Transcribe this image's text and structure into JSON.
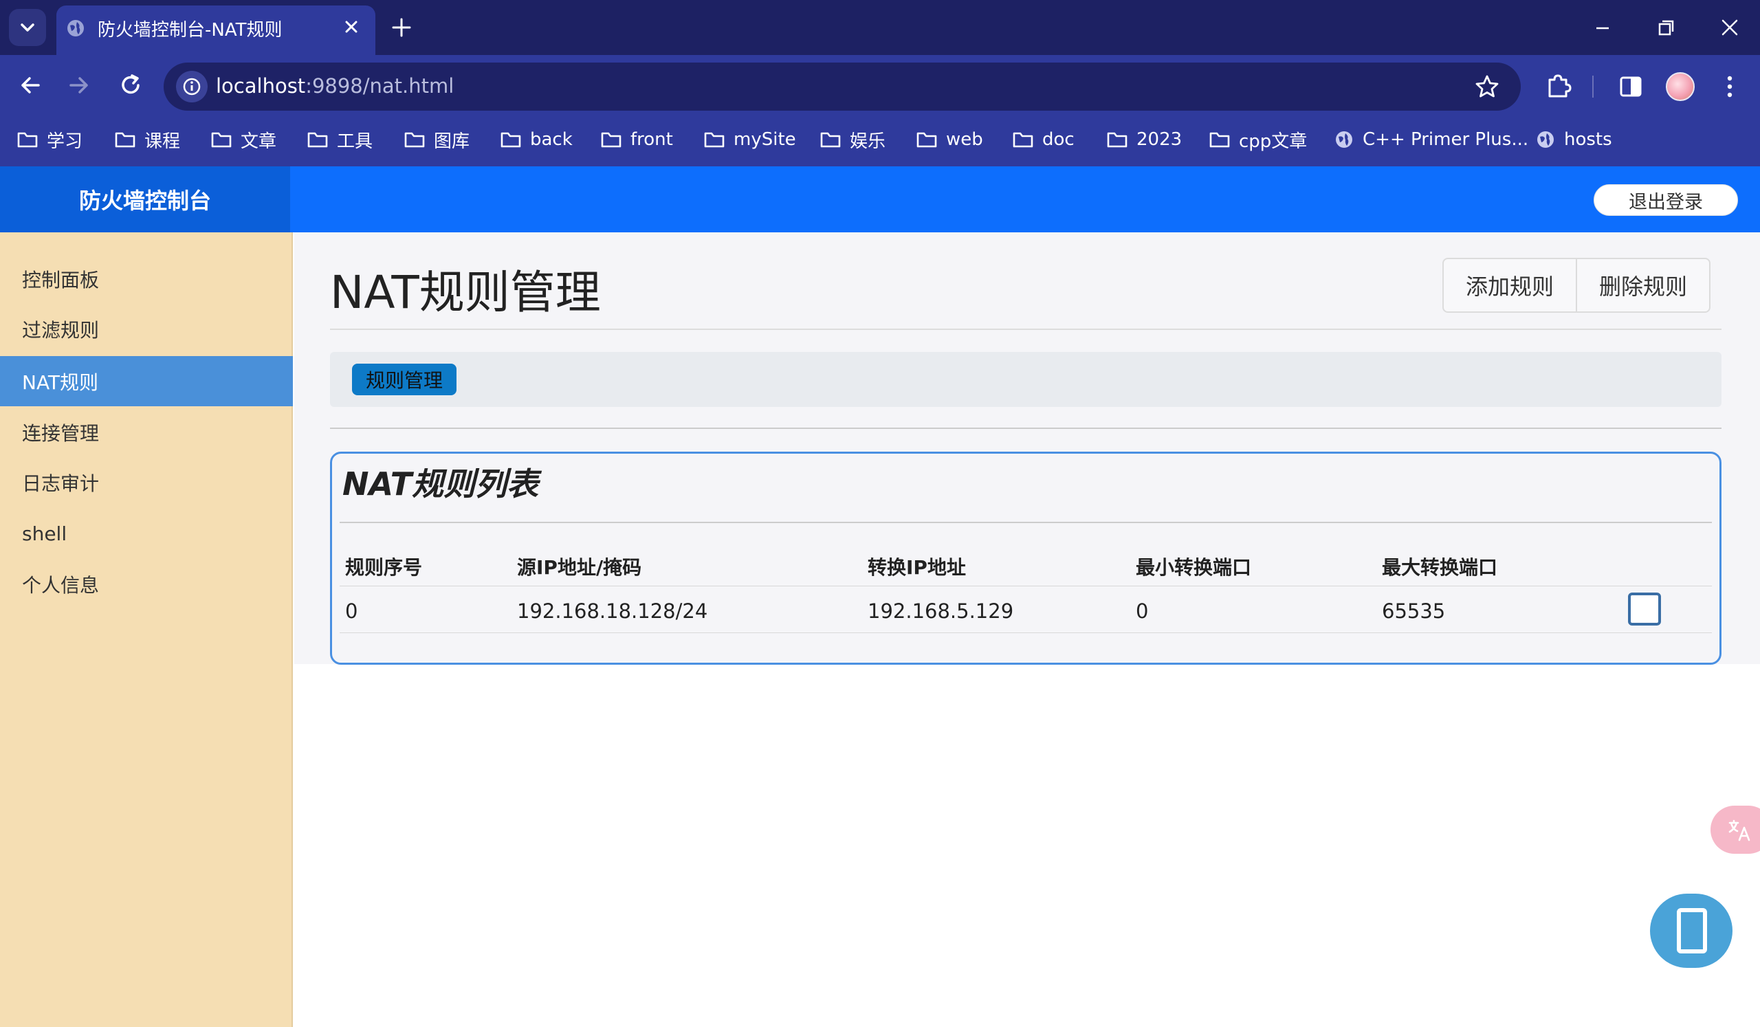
{
  "browser": {
    "tab_title": "防火墙控制台-NAT规则",
    "url_host": "localhost",
    "url_rest": ":9898/nat.html",
    "bookmarks": [
      {
        "label": "学习",
        "icon": "folder-icon"
      },
      {
        "label": "课程",
        "icon": "folder-icon"
      },
      {
        "label": "文章",
        "icon": "folder-icon"
      },
      {
        "label": "工具",
        "icon": "folder-icon"
      },
      {
        "label": "图库",
        "icon": "folder-icon"
      },
      {
        "label": "back",
        "icon": "folder-icon"
      },
      {
        "label": "front",
        "icon": "folder-icon"
      },
      {
        "label": "mySite",
        "icon": "folder-icon"
      },
      {
        "label": "娱乐",
        "icon": "folder-icon"
      },
      {
        "label": "web",
        "icon": "folder-icon"
      },
      {
        "label": "doc",
        "icon": "folder-icon"
      },
      {
        "label": "2023",
        "icon": "folder-icon"
      },
      {
        "label": "cpp文章",
        "icon": "folder-icon"
      },
      {
        "label": "C++ Primer Plus...",
        "icon": "globe-icon"
      },
      {
        "label": "hosts",
        "icon": "globe-icon"
      }
    ]
  },
  "header": {
    "brand": "防火墙控制台",
    "logout_label": "退出登录"
  },
  "sidebar": {
    "items": [
      {
        "label": "控制面板",
        "active": false
      },
      {
        "label": "过滤规则",
        "active": false
      },
      {
        "label": "NAT规则",
        "active": true
      },
      {
        "label": "连接管理",
        "active": false
      },
      {
        "label": "日志审计",
        "active": false
      },
      {
        "label": "shell",
        "active": false
      },
      {
        "label": "个人信息",
        "active": false
      }
    ]
  },
  "main": {
    "title": "NAT规则管理",
    "add_label": "添加规则",
    "delete_label": "删除规则",
    "tab_label": "规则管理",
    "card_title": "NAT规则列表",
    "table": {
      "headers": [
        "规则序号",
        "源IP地址/掩码",
        "转换IP地址",
        "最小转换端口",
        "最大转换端口"
      ],
      "rows": [
        {
          "cells": [
            "0",
            "192.168.18.128/24",
            "192.168.5.129",
            "0",
            "65535"
          ],
          "checked": false
        }
      ]
    }
  },
  "colors": {
    "header_blue": "#0d6efd",
    "sidebar_bg": "#f5deb3",
    "sidebar_active": "#4a90d9",
    "tab_pill": "#0d7ac7",
    "card_border": "#4a90e2",
    "chrome_dark": "#1d2163",
    "chrome_toolbar": "#2f3a9c"
  }
}
